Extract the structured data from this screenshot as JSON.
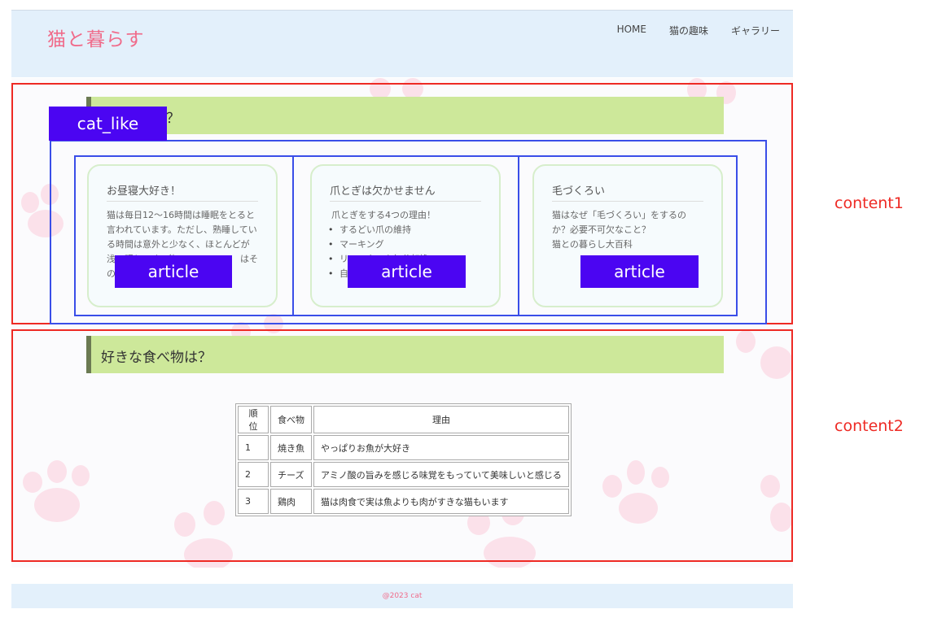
{
  "site": {
    "logo": "猫と暮らす"
  },
  "nav": {
    "items": [
      "HOME",
      "猫の趣味",
      "ギャラリー"
    ]
  },
  "content1": {
    "heading": "？",
    "region_label": "content1",
    "overlay_label": "cat_like",
    "article_label": "article",
    "cards": [
      {
        "title": "お昼寝大好き！",
        "body": "猫は毎日12〜16時間は睡眠をとると言われています。ただし、熟睡している時間は意外と少なく、ほとんどが浅い眠りです。物",
        "tail": "はそ",
        "tail2": "の"
      },
      {
        "title": "爪とぎは欠かせません",
        "intro": "爪とぎをする4つの理由！",
        "items": [
          "するどい爪の維持",
          "マーキング",
          "リラックスや気分転換",
          "自己"
        ]
      },
      {
        "title": "毛づくろい",
        "body": "猫はなぜ「毛づくろい」をするのか？必要不可欠なこと？",
        "extra": "猫との暮らし大百科"
      }
    ]
  },
  "content2": {
    "heading": "好きな食べ物は？",
    "region_label": "content2",
    "table": {
      "headers": [
        "順位",
        "食べ物",
        "理由"
      ],
      "rows": [
        [
          "1",
          "焼き魚",
          "やっぱりお魚が大好き"
        ],
        [
          "2",
          "チーズ",
          "アミノ酸の旨みを感じる味覚をもっていて美味しいと感じる"
        ],
        [
          "3",
          "鶏肉",
          "猫は肉食で実は魚よりも肉がすきな猫もいます"
        ]
      ]
    }
  },
  "footer": {
    "copyright": "@2023 cat"
  },
  "colors": {
    "accent_pink": "#f06b8a",
    "header_bg": "#e3f0fb",
    "heading_bar": "#cde89a",
    "outline_red": "#ee2a24",
    "outline_blue": "#3a4ee8",
    "tag_bg": "#4b05f2"
  }
}
